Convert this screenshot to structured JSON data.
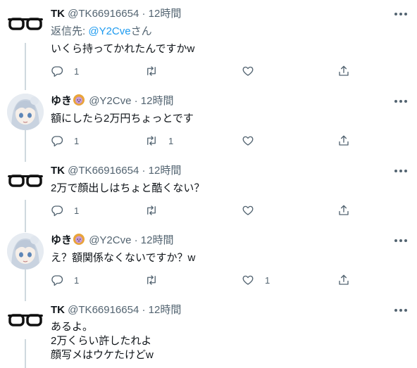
{
  "tweets": [
    {
      "name": "TK",
      "handle": "@TK66916654",
      "dot": "·",
      "time": "12時間",
      "reply_prefix": "返信先: ",
      "reply_handle": "@Y2Cve",
      "reply_suffix": "さん",
      "lines": [
        "いくら持ってかれたんですかw"
      ],
      "reply_count": "1",
      "retweet_count": "",
      "like_count": ""
    },
    {
      "name": "ゆき",
      "handle": "@Y2Cve",
      "dot": "·",
      "time": "12時間",
      "lines": [
        "額にしたら2万円ちょっとです"
      ],
      "reply_count": "1",
      "retweet_count": "1",
      "like_count": ""
    },
    {
      "name": "TK",
      "handle": "@TK66916654",
      "dot": "·",
      "time": "12時間",
      "lines": [
        "2万で顔出しはちょと酷くない？"
      ],
      "reply_count": "1",
      "retweet_count": "",
      "like_count": ""
    },
    {
      "name": "ゆき",
      "handle": "@Y2Cve",
      "dot": "·",
      "time": "12時間",
      "lines": [
        "え？額関係なくないですか？w"
      ],
      "reply_count": "1",
      "retweet_count": "",
      "like_count": "1"
    },
    {
      "name": "TK",
      "handle": "@TK66916654",
      "dot": "·",
      "time": "12時間",
      "lines": [
        "あるよ。",
        "2万くらい許したれよ",
        "顔写メはウケたけどw"
      ],
      "reply_count": "",
      "retweet_count": "",
      "like_count": ""
    }
  ],
  "icons": {
    "more": "more-dots-icon",
    "reply": "reply-icon",
    "retweet": "retweet-icon",
    "like": "heart-icon",
    "share": "share-icon",
    "avatar_tk": "glasses-icon",
    "avatar_yuki": "anime-avatar",
    "badge": "lion-badge-icon"
  },
  "colors": {
    "link": "#1d9bf0",
    "secondary": "#536471",
    "thread_line": "#cfd9de"
  }
}
